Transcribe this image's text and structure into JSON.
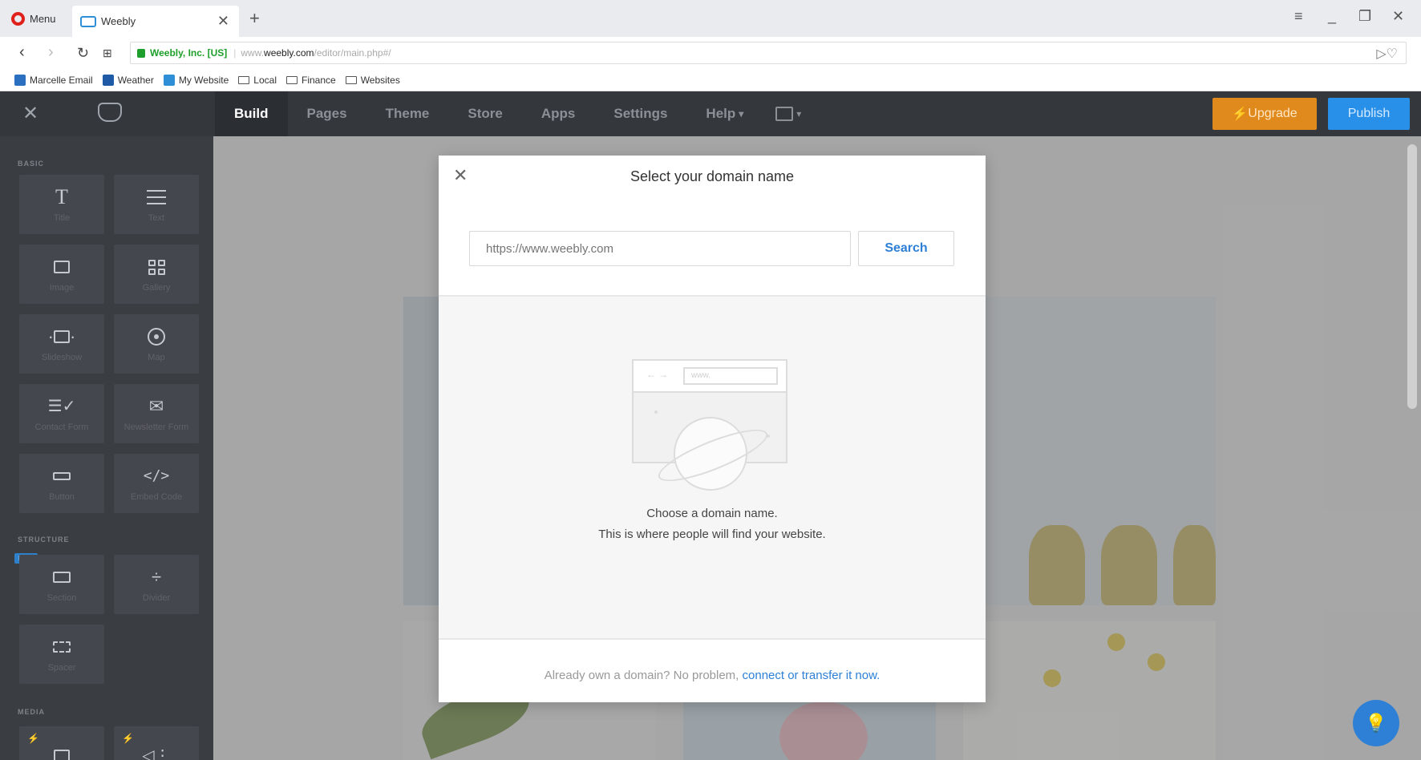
{
  "browser": {
    "menu_label": "Menu",
    "tab_title": "Weebly",
    "secure_label": "Weebly, Inc. [US]",
    "url_prefix": "www.",
    "url_domain": "weebly.com",
    "url_path": "/editor/main.php#/",
    "bookmarks": [
      "Marcelle Email",
      "Weather",
      "My Website",
      "Local",
      "Finance",
      "Websites"
    ]
  },
  "weebly_nav": {
    "items": [
      "Build",
      "Pages",
      "Theme",
      "Store",
      "Apps",
      "Settings",
      "Help"
    ],
    "active": "Build",
    "upgrade_label": "Upgrade",
    "publish_label": "Publish"
  },
  "sidebar": {
    "sections": [
      "BASIC",
      "STRUCTURE",
      "MEDIA"
    ],
    "basic_tiles": [
      {
        "label": "Title",
        "icon": "title-icon"
      },
      {
        "label": "Text",
        "icon": "text-icon"
      },
      {
        "label": "Image",
        "icon": "image-icon"
      },
      {
        "label": "Gallery",
        "icon": "gallery-icon"
      },
      {
        "label": "Slideshow",
        "icon": "slideshow-icon"
      },
      {
        "label": "Map",
        "icon": "map-icon"
      },
      {
        "label": "Contact Form",
        "icon": "contact-form-icon"
      },
      {
        "label": "Newsletter Form",
        "icon": "newsletter-icon"
      },
      {
        "label": "Button",
        "icon": "button-icon"
      },
      {
        "label": "Embed Code",
        "icon": "embed-code-icon"
      }
    ],
    "structure_tiles": [
      {
        "label": "Section",
        "icon": "section-icon"
      },
      {
        "label": "Divider",
        "icon": "divider-icon"
      },
      {
        "label": "Spacer",
        "icon": "spacer-icon"
      }
    ],
    "new_badge": "NEW",
    "media_tiles": [
      {
        "label": "",
        "icon": "video-icon"
      },
      {
        "label": "",
        "icon": "audio-icon"
      }
    ]
  },
  "modal": {
    "title": "Select your domain name",
    "input_placeholder": "https://www.weebly.com",
    "search_label": "Search",
    "illustration_url": "www.",
    "message_line1": "Choose a domain name.",
    "message_line2": "This is where people will find your website.",
    "footer_text": "Already own a domain? No problem, ",
    "footer_link": "connect or transfer it now."
  },
  "colors": {
    "accent_blue": "#2d80d6",
    "upgrade_orange": "#e08a1e",
    "publish_blue": "#2990ea",
    "topbar": "#34373c",
    "sidebar": "#3a3d42"
  }
}
